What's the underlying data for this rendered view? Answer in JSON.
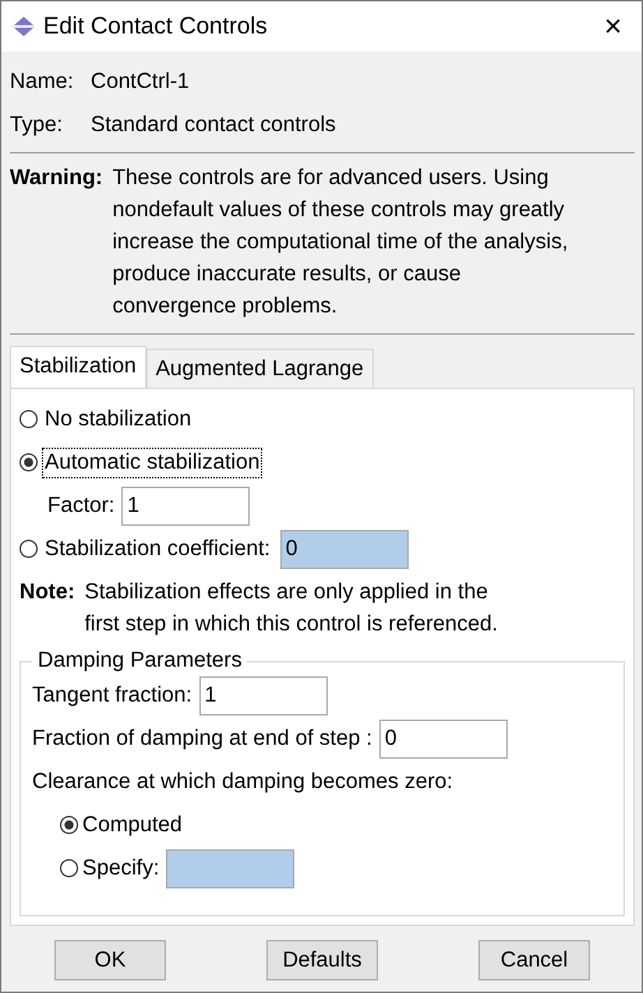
{
  "window": {
    "title": "Edit Contact Controls",
    "close": "×"
  },
  "name": {
    "label": "Name:",
    "value": "ContCtrl-1"
  },
  "type": {
    "label": "Type:",
    "value": "Standard contact controls"
  },
  "warning": {
    "label": "Warning:",
    "text": "These controls are for advanced users. Using nondefault values of these controls may greatly increase the computational time of the analysis, produce inaccurate results, or cause convergence problems."
  },
  "tabs": [
    {
      "label": "Stabilization",
      "selected": true
    },
    {
      "label": "Augmented Lagrange",
      "selected": false
    }
  ],
  "stabilization": [
    {
      "label": "No stabilization",
      "selected": false,
      "focused": false
    },
    {
      "label": "Automatic stabilization",
      "selected": true,
      "focused": true,
      "field": {
        "label": "Factor:",
        "value": "1",
        "disabled": false
      }
    },
    {
      "label": "Stabilization coefficient:",
      "selected": false,
      "focused": false,
      "inline_field": {
        "value": "0",
        "disabled": true
      }
    }
  ],
  "note": {
    "label": "Note:",
    "text": "Stabilization effects are only applied in the first step in which this control is referenced."
  },
  "damping": {
    "title": "Damping Parameters",
    "fields": [
      {
        "label": "Tangent fraction:",
        "value": "1",
        "disabled": false
      },
      {
        "label": "Fraction of damping at end of step :",
        "value": "0",
        "disabled": false
      }
    ],
    "clearance_label": "Clearance at which damping becomes zero:",
    "clearance": [
      {
        "label": "Computed",
        "selected": true
      },
      {
        "label": "Specify:",
        "selected": false,
        "field": {
          "disabled": true
        }
      }
    ]
  },
  "buttons": [
    "OK",
    "Defaults",
    "Cancel"
  ]
}
